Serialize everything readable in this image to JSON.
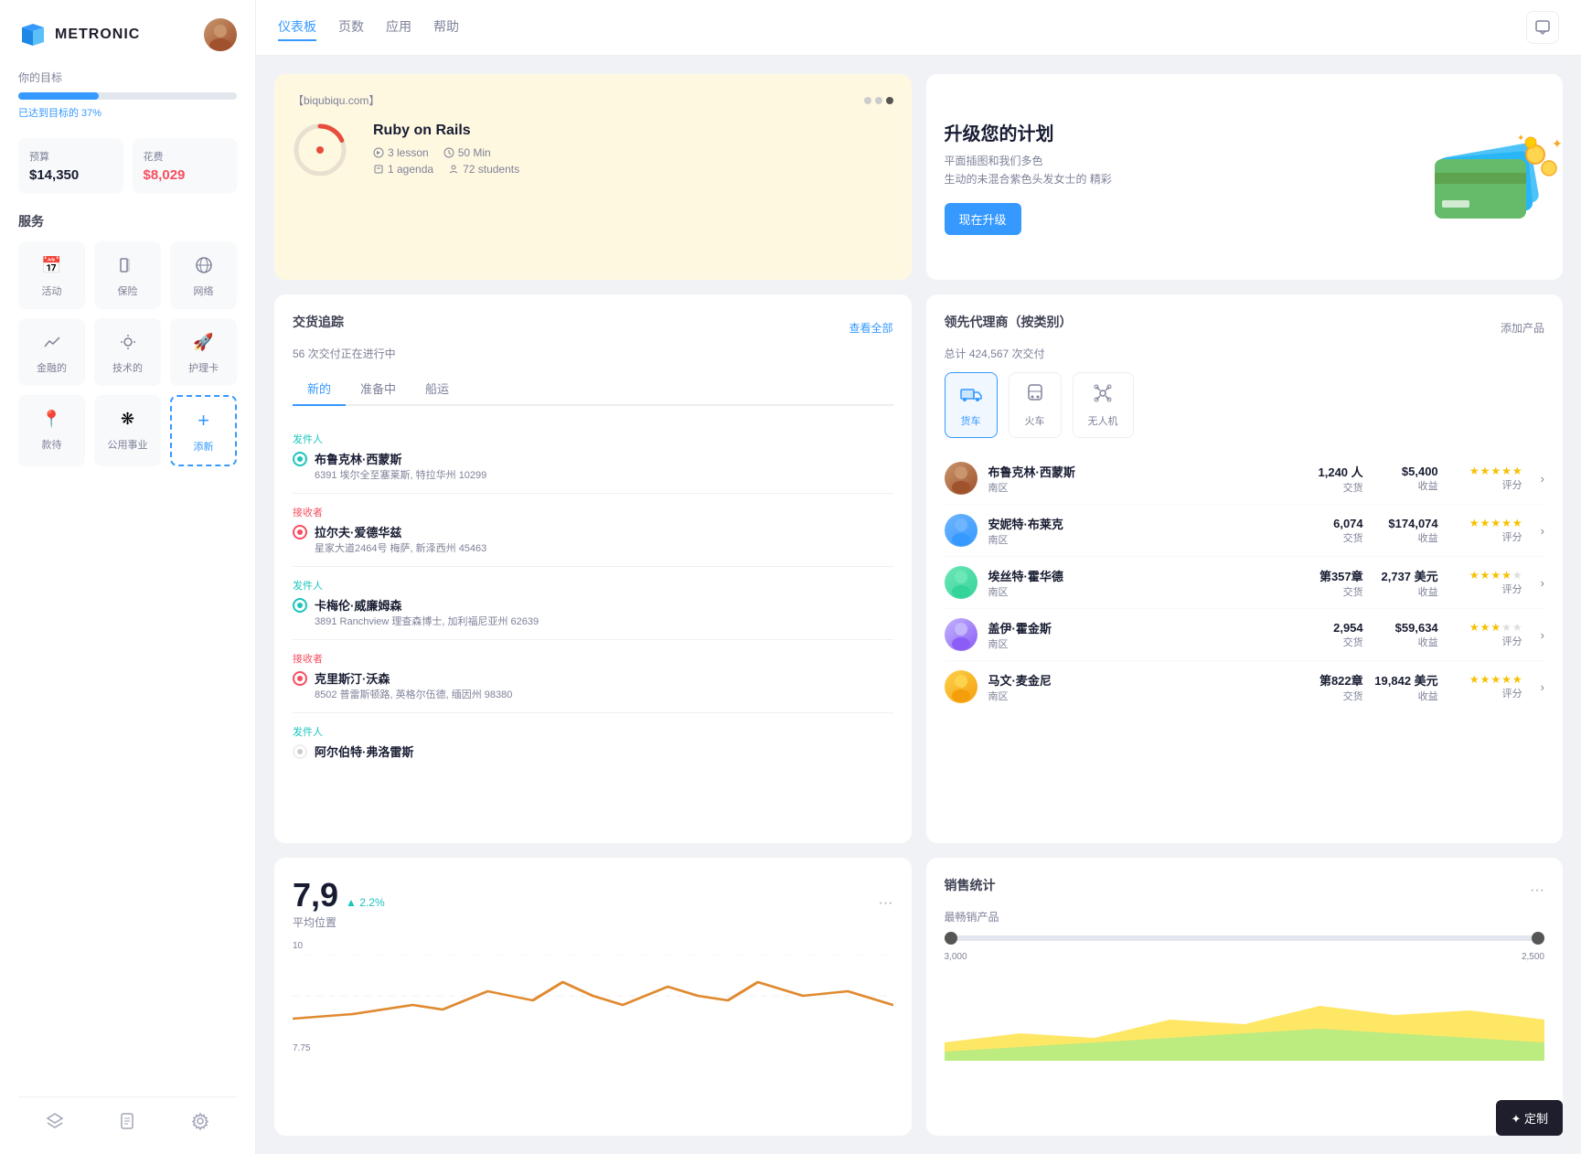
{
  "sidebar": {
    "logo_text": "METRONIC",
    "goal_label": "你的目标",
    "goal_percent_label": "已达到目标的 37%",
    "goal_percent": 37,
    "budget_label": "预算",
    "budget_value": "$14,350",
    "expense_label": "花费",
    "expense_value": "$8,029",
    "services_title": "服务",
    "services": [
      {
        "label": "活动",
        "icon": "📅"
      },
      {
        "label": "保险",
        "icon": "🛡"
      },
      {
        "label": "网络",
        "icon": "🌐"
      },
      {
        "label": "金融的",
        "icon": "💹"
      },
      {
        "label": "技术的",
        "icon": "⚙"
      },
      {
        "label": "护理卡",
        "icon": "🚀"
      },
      {
        "label": "款待",
        "icon": "📍"
      },
      {
        "label": "公用事业",
        "icon": "❋"
      },
      {
        "label": "添新",
        "icon": "+"
      }
    ]
  },
  "topbar": {
    "nav_items": [
      "仪表板",
      "页数",
      "应用",
      "帮助"
    ],
    "active_nav": "仪表板"
  },
  "course_card": {
    "url": "【biqubiqu.com】",
    "dots": [
      "gray",
      "gray",
      "dark"
    ],
    "title": "Ruby on Rails",
    "lessons": "3 lesson",
    "duration": "50 Min",
    "agenda": "1 agenda",
    "students": "72 students"
  },
  "upgrade_card": {
    "title": "升级您的计划",
    "desc_line1": "平面插图和我们多色",
    "desc_line2": "生动的未混合紫色头发女士的 精彩",
    "button_label": "现在升级"
  },
  "tracking_card": {
    "title": "交货追踪",
    "subtitle": "56 次交付正在进行中",
    "view_all": "查看全部",
    "tabs": [
      "新的",
      "准备中",
      "船运"
    ],
    "active_tab": "新的",
    "shipments": [
      {
        "type": "发件人",
        "name": "布鲁克林·西蒙斯",
        "address": "6391 埃尔全至塞莱斯, 特拉华州 10299",
        "dot_type": "sender"
      },
      {
        "type": "接收者",
        "name": "拉尔夫·爱德华兹",
        "address": "星家大道2464号 梅萨, 新泽西州 45463",
        "dot_type": "receiver"
      },
      {
        "type": "发件人",
        "name": "卡梅伦·威廉姆森",
        "address": "3891 Ranchview 理查森博士, 加利福尼亚州 62639",
        "dot_type": "sender"
      },
      {
        "type": "接收者",
        "name": "克里斯汀·沃森",
        "address": "8502 普雷斯顿路, 英格尔伍德, 缅因州 98380",
        "dot_type": "receiver"
      },
      {
        "type": "发件人",
        "name": "阿尔伯特·弗洛雷斯",
        "address": "",
        "dot_type": "sender"
      }
    ]
  },
  "agents_card": {
    "title": "领先代理商（按类别）",
    "subtitle": "总计 424,567 次交付",
    "add_button": "添加产品",
    "categories": [
      "货车",
      "火车",
      "无人机"
    ],
    "active_category": "货车",
    "agents": [
      {
        "name": "布鲁克林·西蒙斯",
        "zone": "南区",
        "transactions": "1,240 人",
        "revenue": "$5,400",
        "rating": 5,
        "av_class": "av-brown"
      },
      {
        "name": "安妮特·布莱克",
        "zone": "南区",
        "transactions": "6,074",
        "revenue": "$174,074",
        "rating": 5,
        "av_class": "av-blue"
      },
      {
        "name": "埃丝特·霍华德",
        "zone": "南区",
        "transactions": "第357章",
        "revenue": "2,737 美元",
        "rating": 4,
        "av_class": "av-green"
      },
      {
        "name": "盖伊·霍金斯",
        "zone": "南区",
        "transactions": "2,954",
        "revenue": "$59,634",
        "rating": 3,
        "av_class": "av-purple"
      },
      {
        "name": "马文·麦金尼",
        "zone": "南区",
        "transactions": "第822章",
        "revenue": "19,842 美元",
        "rating": 5,
        "av_class": "av-orange"
      }
    ],
    "col_labels": {
      "transactions": "交货",
      "revenue": "收益",
      "rating": "评分"
    }
  },
  "stats_card": {
    "big_number": "7,9",
    "trend": "▲ 2.2%",
    "label": "平均位置",
    "chart_y_labels": [
      "10",
      "7.75"
    ],
    "chart_color": "#e08a30"
  },
  "sales_card": {
    "title": "销售统计",
    "subtitle": "最畅销产品",
    "y_labels": [
      "3,000",
      "2,500"
    ],
    "chart_colors": [
      "#ffd700",
      "#90ee90"
    ]
  },
  "customize_button": "✦ 定制"
}
